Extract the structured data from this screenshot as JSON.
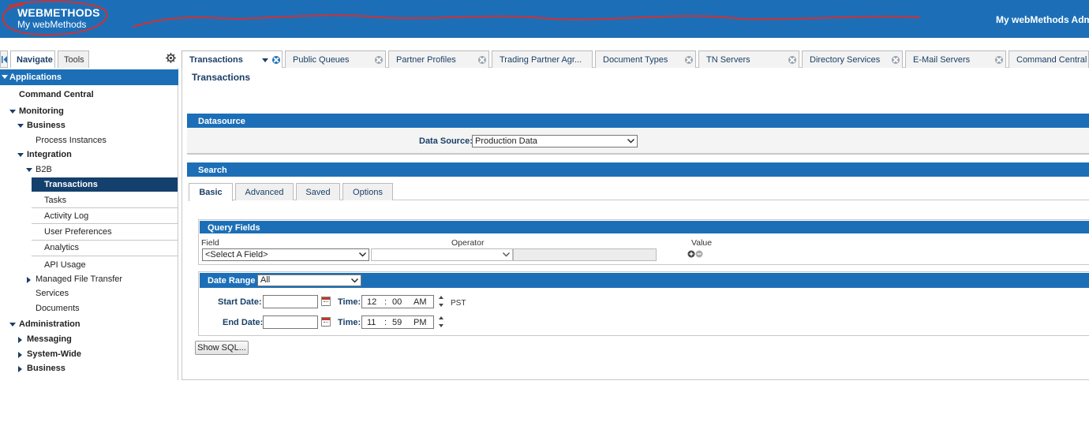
{
  "header": {
    "brand_title": "WEBMETHODS",
    "brand_subtitle": "My webMethods",
    "user_area": "My webMethods Admin",
    "bg_color": "#1c6fb7"
  },
  "nav": {
    "tabs": [
      "Navigate",
      "Tools"
    ],
    "section": "Applications",
    "items": {
      "command_central": "Command Central",
      "monitoring": "Monitoring",
      "business": "Business",
      "process_instances": "Process Instances",
      "integration": "Integration",
      "b2b": "B2B",
      "transactions": "Transactions",
      "tasks": "Tasks",
      "activity_log": "Activity Log",
      "user_preferences": "User Preferences",
      "analytics": "Analytics",
      "api_usage": "API Usage",
      "managed_file_transfer": "Managed File Transfer",
      "services": "Services",
      "documents": "Documents",
      "administration": "Administration",
      "messaging": "Messaging",
      "system_wide": "System-Wide",
      "admin_business": "Business"
    }
  },
  "tabs": [
    "Transactions",
    "Public Queues",
    "Partner Profiles",
    "Trading Partner Agr...",
    "Document Types",
    "TN Servers",
    "Directory Services",
    "E-Mail Servers",
    "Command Central"
  ],
  "page": {
    "title": "Transactions",
    "datasource": {
      "heading": "Datasource",
      "label": "Data Source:",
      "value": "Production Data"
    },
    "search": {
      "heading": "Search",
      "tabs": [
        "Basic",
        "Advanced",
        "Saved",
        "Options"
      ]
    },
    "query": {
      "heading": "Query Fields",
      "col_field": "Field",
      "col_operator": "Operator",
      "col_value": "Value",
      "field_value": "<Select A Field>",
      "operator_value": "",
      "value_value": ""
    },
    "date_range": {
      "heading": "Date Range",
      "value": "All",
      "start_label": "Start Date:",
      "end_label": "End Date:",
      "time_label": "Time:",
      "start_date": "",
      "end_date": "",
      "start_hour": "12",
      "start_min": "00",
      "start_ampm": "AM",
      "end_hour": "11",
      "end_min": "59",
      "end_ampm": "PM",
      "colon": ":",
      "timezone": "PST"
    },
    "show_sql": "Show SQL..."
  }
}
